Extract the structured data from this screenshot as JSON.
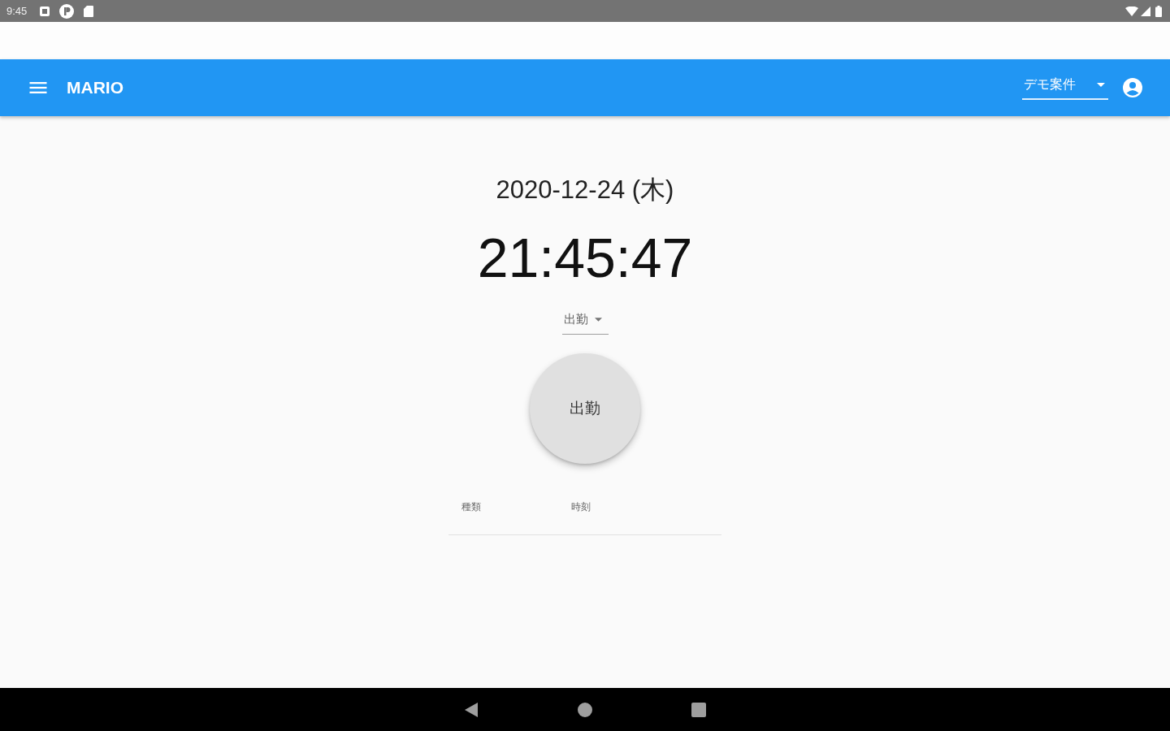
{
  "status_bar": {
    "time": "9:45"
  },
  "app_bar": {
    "title": "MARIO",
    "project_select": {
      "value": "デモ案件"
    }
  },
  "clock": {
    "date": "2020-12-24 (木)",
    "time": "21:45:47"
  },
  "punch_type_select": {
    "value": "出勤"
  },
  "punch_button": {
    "label": "出勤"
  },
  "table": {
    "columns": [
      "種類",
      "時刻"
    ]
  }
}
